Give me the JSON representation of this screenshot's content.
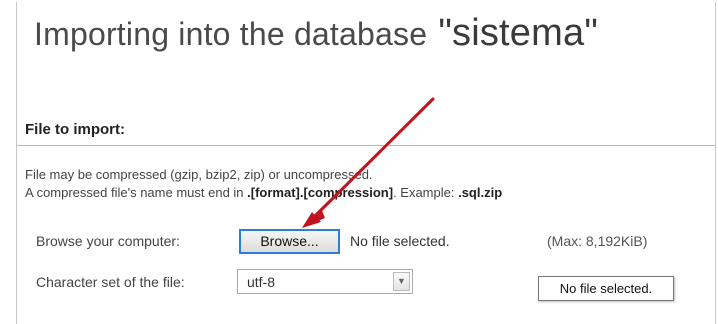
{
  "page": {
    "title": "Importing into the database",
    "database_name": "\"sistema\""
  },
  "section": {
    "heading": "File to import:"
  },
  "info": {
    "line1": "File may be compressed (gzip, bzip2, zip) or uncompressed.",
    "line2_prefix": "A compressed file's name must end in ",
    "line2_format": ".[format].[compression]",
    "line2_mid": ". Example: ",
    "line2_example": ".sql.zip"
  },
  "file_row": {
    "label": "Browse your computer:",
    "browse_label": "Browse...",
    "status": "No file selected.",
    "max_size": "(Max: 8,192KiB)"
  },
  "charset_row": {
    "label": "Character set of the file:",
    "selected": "utf-8"
  },
  "tooltip": {
    "text": "No file selected."
  },
  "colors": {
    "annotation_arrow": "#c0141e",
    "button_focus_border": "#2e7dd7"
  }
}
